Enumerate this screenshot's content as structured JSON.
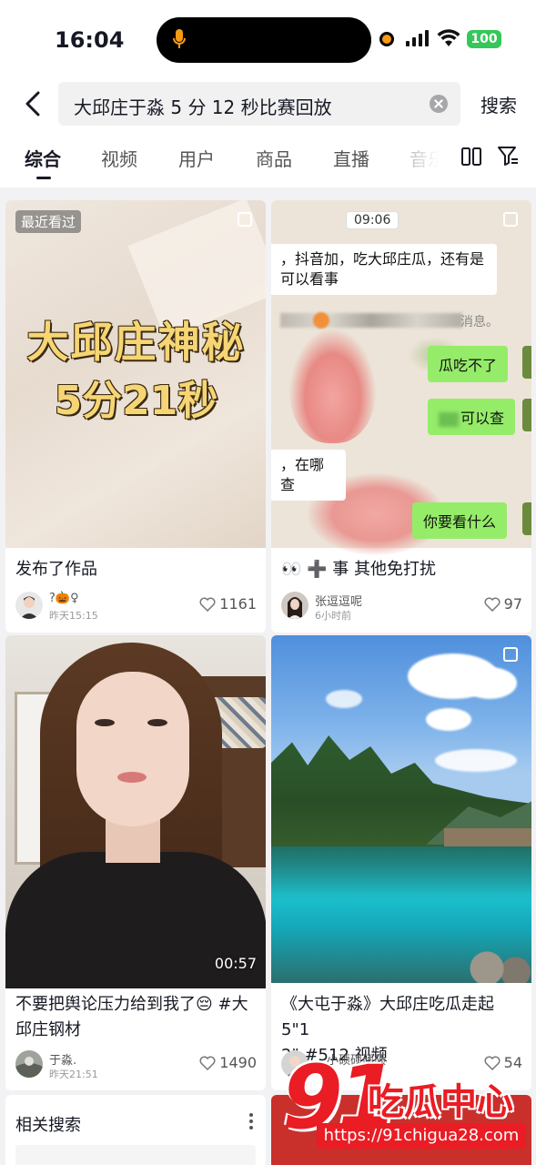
{
  "status_bar": {
    "time": "16:04",
    "battery": "100",
    "icons": [
      "microphone-icon",
      "recording-dot-icon",
      "signal-icon",
      "wifi-icon",
      "battery-icon"
    ]
  },
  "search": {
    "query": "大邱庄于淼 5 分 12 秒比赛回放",
    "submit_label": "搜索"
  },
  "tabs": [
    {
      "label": "综合",
      "active": true
    },
    {
      "label": "视频"
    },
    {
      "label": "用户"
    },
    {
      "label": "商品"
    },
    {
      "label": "直播"
    },
    {
      "label": "音乐"
    }
  ],
  "results": [
    {
      "badge": "最近看过",
      "thumb_title_1": "大邱庄神秘",
      "thumb_title_2": "5分21秒",
      "caption": "发布了作品",
      "author": "?🎃♀",
      "time": "昨天15:15",
      "likes": "1161"
    },
    {
      "chat_time": "09:06",
      "chat_msg_1": "，抖音加，吃大邱庄瓜，还有是",
      "chat_msg_2": "可以看事",
      "chat_notice": "消息。",
      "chat_reply_1": "瓜吃不了",
      "chat_reply_2": "可以查",
      "chat_msg_3": "，在哪查",
      "chat_reply_3": "你要看什么",
      "caption": "👀 ➕ 事 其他免打扰",
      "author": "张逗逗呢",
      "time": "6小时前",
      "likes": "97"
    },
    {
      "duration": "00:57",
      "caption_line1": "不要把舆论压力给到我了😔 #大",
      "caption_line2": "邱庄钢材",
      "author": "于淼.",
      "time": "昨天21:51",
      "likes": "1490"
    },
    {
      "caption_line1": "《大屯于淼》大邱庄吃瓜走起 5\"1",
      "caption_line2": "2\" #512 视频",
      "author": "小硕硕硕硕",
      "likes": "54"
    }
  ],
  "related": {
    "title": "相关搜索"
  },
  "watermark": {
    "brand_number": "91",
    "brand_name": "吃瓜中心",
    "url": "https://91chigua28.com"
  },
  "colors": {
    "accent_green": "#95ec69",
    "watermark_red": "#ea1c24",
    "battery_green": "#35c759"
  }
}
